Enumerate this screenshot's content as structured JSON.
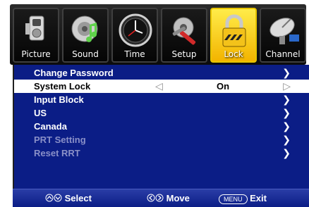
{
  "tabs": [
    {
      "label": "Picture",
      "icon": "camera-icon"
    },
    {
      "label": "Sound",
      "icon": "speaker-icon"
    },
    {
      "label": "Time",
      "icon": "clock-icon"
    },
    {
      "label": "Setup",
      "icon": "wrench-icon"
    },
    {
      "label": "Lock",
      "icon": "lock-icon"
    },
    {
      "label": "Channel",
      "icon": "satellite-dish-icon"
    }
  ],
  "active_tab": "Lock",
  "menu": {
    "items": [
      {
        "label": "Change Password",
        "arrow": "❯"
      },
      {
        "label": "System Lock",
        "left_arrow": "◁",
        "value": "On",
        "arrow": "▷"
      },
      {
        "label": "Input Block",
        "arrow": "❯"
      },
      {
        "label": "US",
        "arrow": "❯"
      },
      {
        "label": "Canada",
        "arrow": "❯"
      },
      {
        "label": "PRT Setting",
        "arrow": "❯"
      },
      {
        "label": "Reset RRT",
        "arrow": "❯"
      }
    ],
    "selected_item": "System Lock",
    "disabled_items": [
      "PRT Setting",
      "Reset RRT"
    ]
  },
  "helpbar": {
    "select_label": "Select",
    "move_label": "Move",
    "menu_key": "MENU",
    "exit_label": "Exit"
  },
  "colors": {
    "panel": "#0b1d86",
    "active_tab": "#f7c400",
    "selected_row": "#ffffff",
    "disabled_text": "#8a90c8"
  }
}
